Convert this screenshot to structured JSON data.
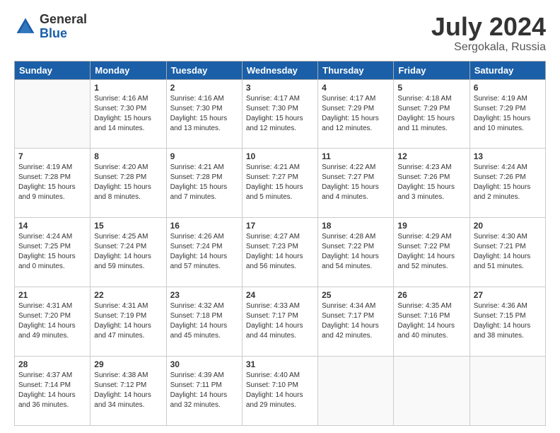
{
  "header": {
    "logo_general": "General",
    "logo_blue": "Blue",
    "month_year": "July 2024",
    "location": "Sergokala, Russia"
  },
  "days": [
    "Sunday",
    "Monday",
    "Tuesday",
    "Wednesday",
    "Thursday",
    "Friday",
    "Saturday"
  ],
  "weeks": [
    [
      {
        "day": "",
        "sunrise": "",
        "sunset": "",
        "daylight": ""
      },
      {
        "day": "1",
        "sunrise": "4:16 AM",
        "sunset": "7:30 PM",
        "daylight": "15 hours and 14 minutes."
      },
      {
        "day": "2",
        "sunrise": "4:16 AM",
        "sunset": "7:30 PM",
        "daylight": "15 hours and 13 minutes."
      },
      {
        "day": "3",
        "sunrise": "4:17 AM",
        "sunset": "7:30 PM",
        "daylight": "15 hours and 12 minutes."
      },
      {
        "day": "4",
        "sunrise": "4:17 AM",
        "sunset": "7:29 PM",
        "daylight": "15 hours and 12 minutes."
      },
      {
        "day": "5",
        "sunrise": "4:18 AM",
        "sunset": "7:29 PM",
        "daylight": "15 hours and 11 minutes."
      },
      {
        "day": "6",
        "sunrise": "4:19 AM",
        "sunset": "7:29 PM",
        "daylight": "15 hours and 10 minutes."
      }
    ],
    [
      {
        "day": "7",
        "sunrise": "4:19 AM",
        "sunset": "7:28 PM",
        "daylight": "15 hours and 9 minutes."
      },
      {
        "day": "8",
        "sunrise": "4:20 AM",
        "sunset": "7:28 PM",
        "daylight": "15 hours and 8 minutes."
      },
      {
        "day": "9",
        "sunrise": "4:21 AM",
        "sunset": "7:28 PM",
        "daylight": "15 hours and 7 minutes."
      },
      {
        "day": "10",
        "sunrise": "4:21 AM",
        "sunset": "7:27 PM",
        "daylight": "15 hours and 5 minutes."
      },
      {
        "day": "11",
        "sunrise": "4:22 AM",
        "sunset": "7:27 PM",
        "daylight": "15 hours and 4 minutes."
      },
      {
        "day": "12",
        "sunrise": "4:23 AM",
        "sunset": "7:26 PM",
        "daylight": "15 hours and 3 minutes."
      },
      {
        "day": "13",
        "sunrise": "4:24 AM",
        "sunset": "7:26 PM",
        "daylight": "15 hours and 2 minutes."
      }
    ],
    [
      {
        "day": "14",
        "sunrise": "4:24 AM",
        "sunset": "7:25 PM",
        "daylight": "15 hours and 0 minutes."
      },
      {
        "day": "15",
        "sunrise": "4:25 AM",
        "sunset": "7:24 PM",
        "daylight": "14 hours and 59 minutes."
      },
      {
        "day": "16",
        "sunrise": "4:26 AM",
        "sunset": "7:24 PM",
        "daylight": "14 hours and 57 minutes."
      },
      {
        "day": "17",
        "sunrise": "4:27 AM",
        "sunset": "7:23 PM",
        "daylight": "14 hours and 56 minutes."
      },
      {
        "day": "18",
        "sunrise": "4:28 AM",
        "sunset": "7:22 PM",
        "daylight": "14 hours and 54 minutes."
      },
      {
        "day": "19",
        "sunrise": "4:29 AM",
        "sunset": "7:22 PM",
        "daylight": "14 hours and 52 minutes."
      },
      {
        "day": "20",
        "sunrise": "4:30 AM",
        "sunset": "7:21 PM",
        "daylight": "14 hours and 51 minutes."
      }
    ],
    [
      {
        "day": "21",
        "sunrise": "4:31 AM",
        "sunset": "7:20 PM",
        "daylight": "14 hours and 49 minutes."
      },
      {
        "day": "22",
        "sunrise": "4:31 AM",
        "sunset": "7:19 PM",
        "daylight": "14 hours and 47 minutes."
      },
      {
        "day": "23",
        "sunrise": "4:32 AM",
        "sunset": "7:18 PM",
        "daylight": "14 hours and 45 minutes."
      },
      {
        "day": "24",
        "sunrise": "4:33 AM",
        "sunset": "7:17 PM",
        "daylight": "14 hours and 44 minutes."
      },
      {
        "day": "25",
        "sunrise": "4:34 AM",
        "sunset": "7:17 PM",
        "daylight": "14 hours and 42 minutes."
      },
      {
        "day": "26",
        "sunrise": "4:35 AM",
        "sunset": "7:16 PM",
        "daylight": "14 hours and 40 minutes."
      },
      {
        "day": "27",
        "sunrise": "4:36 AM",
        "sunset": "7:15 PM",
        "daylight": "14 hours and 38 minutes."
      }
    ],
    [
      {
        "day": "28",
        "sunrise": "4:37 AM",
        "sunset": "7:14 PM",
        "daylight": "14 hours and 36 minutes."
      },
      {
        "day": "29",
        "sunrise": "4:38 AM",
        "sunset": "7:12 PM",
        "daylight": "14 hours and 34 minutes."
      },
      {
        "day": "30",
        "sunrise": "4:39 AM",
        "sunset": "7:11 PM",
        "daylight": "14 hours and 32 minutes."
      },
      {
        "day": "31",
        "sunrise": "4:40 AM",
        "sunset": "7:10 PM",
        "daylight": "14 hours and 29 minutes."
      },
      {
        "day": "",
        "sunrise": "",
        "sunset": "",
        "daylight": ""
      },
      {
        "day": "",
        "sunrise": "",
        "sunset": "",
        "daylight": ""
      },
      {
        "day": "",
        "sunrise": "",
        "sunset": "",
        "daylight": ""
      }
    ]
  ]
}
